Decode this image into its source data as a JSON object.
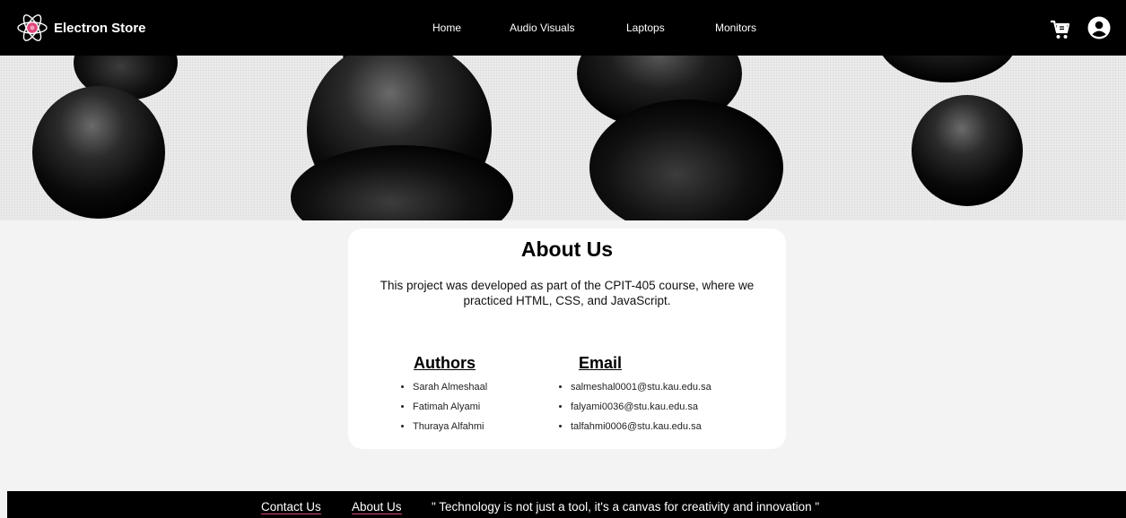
{
  "brand": {
    "name": "Electron Store",
    "accent": "#e0457b"
  },
  "nav": {
    "links": [
      "Home",
      "Audio Visuals",
      "Laptops",
      "Monitors"
    ],
    "icons": [
      "cart-icon",
      "user-icon"
    ]
  },
  "about": {
    "title": "About Us",
    "description": "This project was developed as part of the CPIT-405 course, where we practiced HTML, CSS, and JavaScript.",
    "authors_heading": "Authors",
    "email_heading": "Email",
    "authors": [
      "Sarah Almeshaal",
      "Fatimah Alyami",
      "Thuraya Alfahmi"
    ],
    "emails": [
      "salmeshal0001@stu.kau.edu.sa",
      "falyami0036@stu.kau.edu.sa",
      "talfahmi0006@stu.kau.edu.sa"
    ]
  },
  "footer": {
    "contact": "Contact Us",
    "about": "About Us",
    "quote": "\" Technology is not just a tool, it's a canvas for creativity and innovation \""
  }
}
